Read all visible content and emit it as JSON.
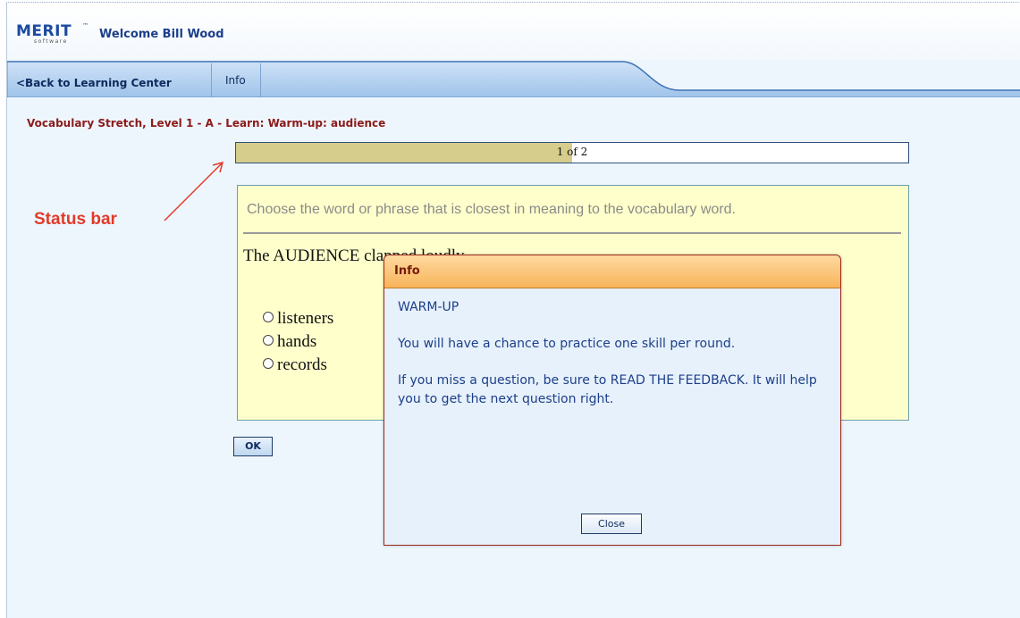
{
  "header": {
    "logo_text": "MERIT",
    "logo_subtext": "software",
    "logo_tm": "™",
    "welcome": "Welcome Bill Wood"
  },
  "nav": {
    "back_label": "<Back to Learning Center",
    "info_label": "Info"
  },
  "breadcrumb": "Vocabulary Stretch, Level 1 - A - Learn: Warm-up: audience",
  "progress": {
    "text": "1 of 2",
    "fraction": 0.5
  },
  "annotation": {
    "label": "Status bar"
  },
  "question": {
    "instruction": "Choose the word or phrase that is closest in meaning to the vocabulary word.",
    "stem": "The AUDIENCE clapped loudly.",
    "options": [
      "listeners",
      "hands",
      "records"
    ]
  },
  "buttons": {
    "ok": "OK"
  },
  "dialog": {
    "title": "Info",
    "heading": "WARM-UP",
    "paragraph1": "You will have a chance to practice one skill per round.",
    "paragraph2": "If you miss a question, be sure to READ THE FEEDBACK. It will help you to get the next question right.",
    "close_label": "Close"
  },
  "colors": {
    "accent": "#1c4aa0",
    "breadcrumb": "#8b1a1a",
    "progress_fill": "#d6cd8d",
    "annotation": "#e23a2a",
    "question_bg": "#ffffcc",
    "dialog_title": "#f7b459"
  }
}
